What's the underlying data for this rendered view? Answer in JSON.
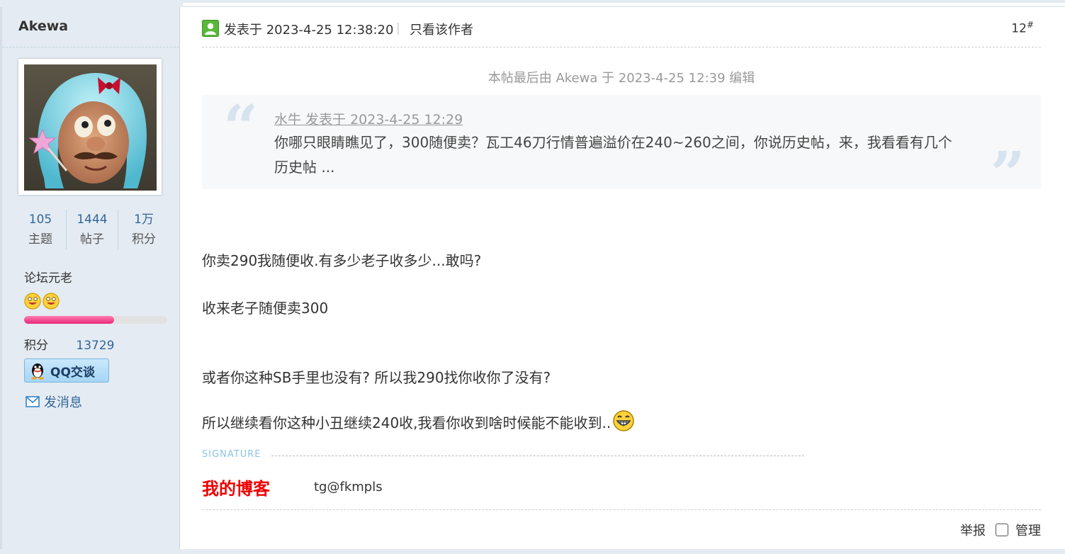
{
  "sidebar": {
    "username": "Akewa",
    "stats": [
      {
        "value": "105",
        "label": "主题"
      },
      {
        "value": "1444",
        "label": "帖子"
      },
      {
        "value": "1万",
        "label": "积分"
      }
    ],
    "group_title": "论坛元老",
    "level_progress": 0.63,
    "points_label": "积分",
    "points_value": "13729",
    "qq_label": "QQ交谈",
    "message_label": "发消息"
  },
  "post": {
    "time": "发表于 2023-4-25 12:38:20",
    "separator": "|",
    "only_author": "只看该作者",
    "floor": "12",
    "floor_mark": "#",
    "edit_note": "本帖最后由 Akewa 于 2023-4-25 12:39 编辑",
    "quote": {
      "source": "水牛 发表于 2023-4-25 12:29",
      "text": "你哪只眼睛瞧见了，300随便卖？瓦工46刀行情普遍溢价在240~260之间，你说历史帖，来，我看看有几个历史帖 ..."
    },
    "lines": [
      "你卖290我随便收.有多少老子收多少...敢吗?",
      "收来老子随便卖300",
      "或者你这种SB手里也没有? 所以我290找你收你了没有?",
      "所以继续看你这种小丑继续240收,我看你收到啥时候能不能收到.."
    ]
  },
  "signature": {
    "label": "SIGNATURE",
    "blog_link": "我的博客",
    "tg": "tg@fkmpls"
  },
  "footer": {
    "report": "举报",
    "manage": "管理"
  },
  "colors": {
    "sidebar_bg": "#e4ebf2",
    "link": "#336699",
    "blog_red": "#ee0000",
    "progress_pink": "#e8287a"
  }
}
